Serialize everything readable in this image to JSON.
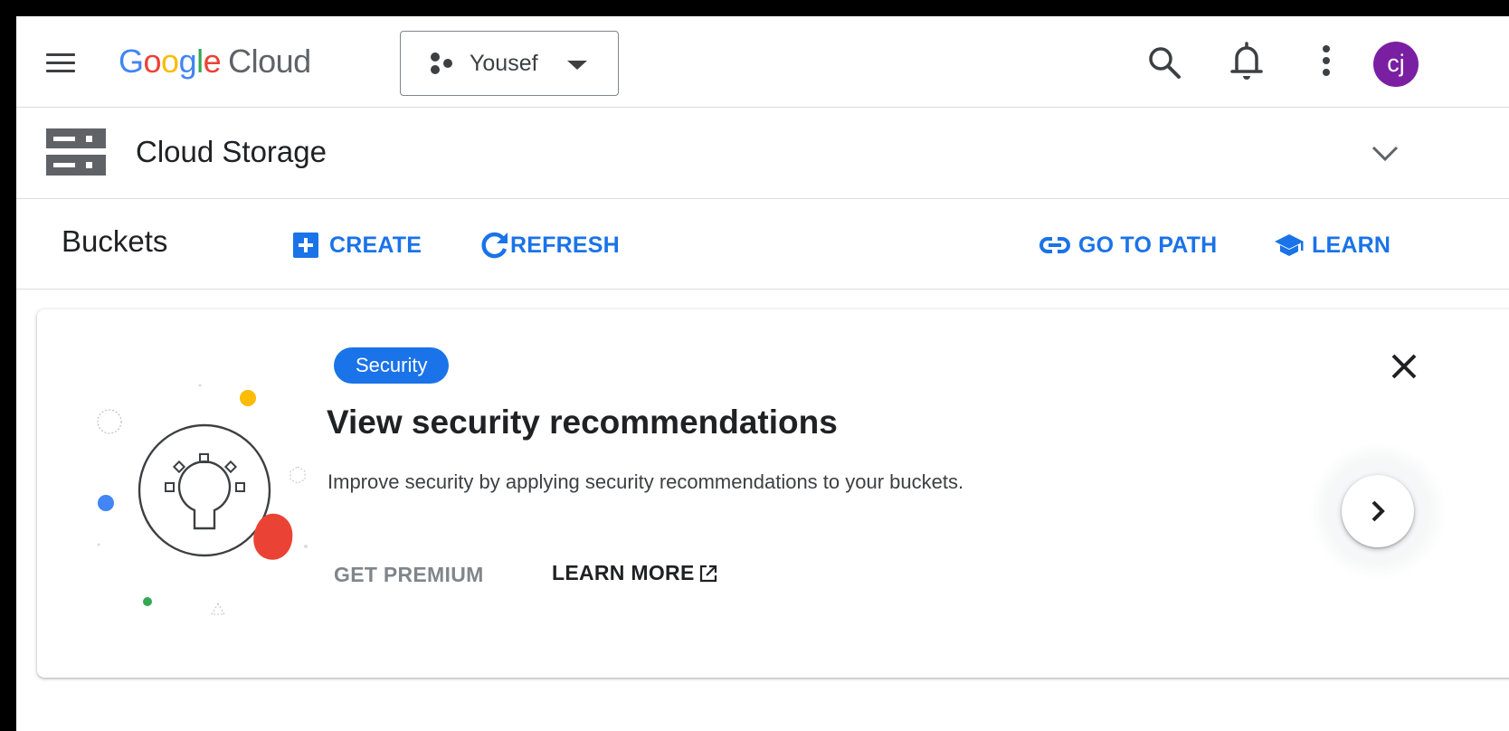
{
  "header": {
    "logo_google": [
      "G",
      "o",
      "o",
      "g",
      "l",
      "e"
    ],
    "logo_cloud": "Cloud",
    "project_name": "Yousef",
    "avatar_initials": "cj",
    "icons": [
      "menu-icon",
      "project-icon",
      "caret-down-icon",
      "search-icon",
      "bell-icon",
      "more-vert-icon"
    ]
  },
  "product": {
    "title": "Cloud Storage",
    "icon": "storage-icon",
    "expand_icon": "chevron-down-icon"
  },
  "page": {
    "title": "Buckets",
    "actions": {
      "create": "CREATE",
      "refresh": "REFRESH",
      "go_to_path": "GO TO PATH",
      "learn": "LEARN"
    }
  },
  "recommendation": {
    "badge": "Security",
    "title": "View security recommendations",
    "description": "Improve security by applying security recommendations to your buckets.",
    "get_premium": "GET PREMIUM",
    "learn_more": "LEARN MORE"
  },
  "colors": {
    "accent": "#1a73e8",
    "avatar": "#7b1fa2",
    "google_blue": "#4285f4",
    "google_red": "#ea4335",
    "google_yellow": "#fbbc05",
    "google_green": "#34a853"
  }
}
